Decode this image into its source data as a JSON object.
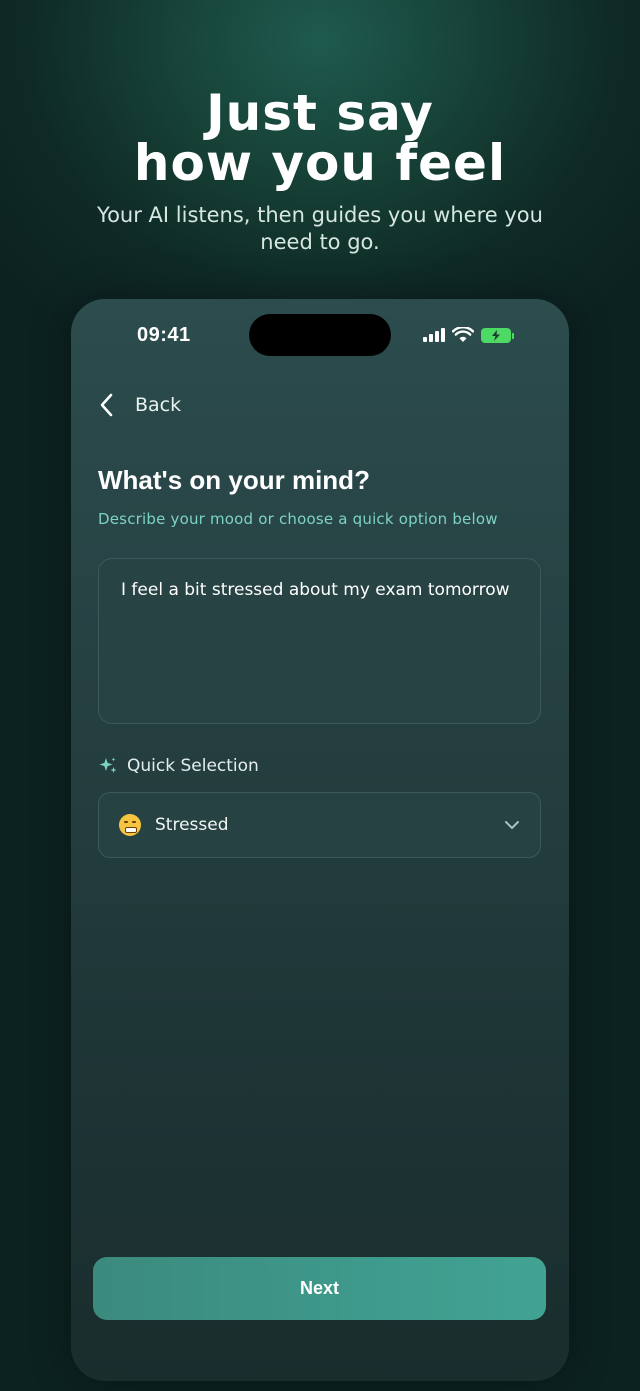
{
  "hero": {
    "title_line1": "Just say",
    "title_line2": "how you feel",
    "subtitle": "Your AI listens, then guides you where you need to go."
  },
  "status_bar": {
    "time": "09:41"
  },
  "nav": {
    "back_label": "Back"
  },
  "question": {
    "title": "What's on your mind?",
    "subtitle": "Describe your mood or choose a quick option below"
  },
  "mood_input": {
    "value": "I feel a bit stressed about my exam tomorrow"
  },
  "quick_selection": {
    "label": "Quick Selection",
    "selected": "Stressed"
  },
  "actions": {
    "next_label": "Next"
  },
  "colors": {
    "accent": "#3e9a8c",
    "subtitle_teal": "#7dd3c3",
    "battery_green": "#4cd964"
  }
}
